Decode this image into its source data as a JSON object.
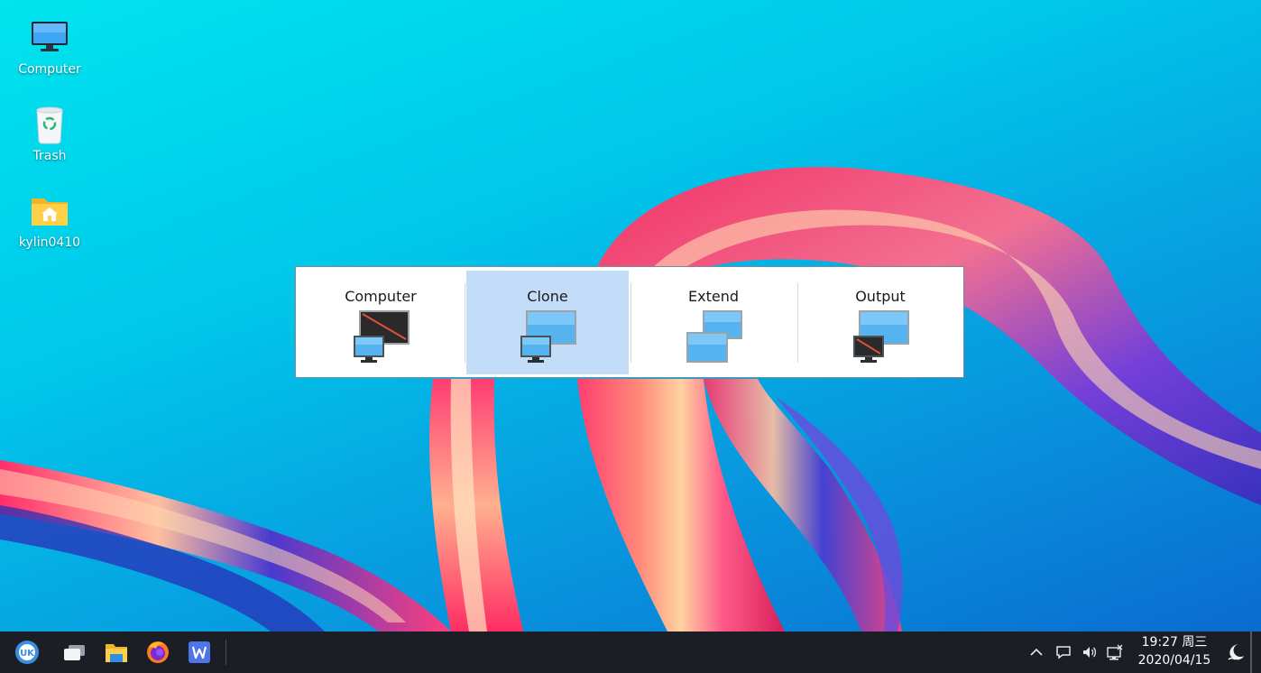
{
  "desktop": {
    "icons": [
      {
        "label": "Computer",
        "icon": "computer-icon"
      },
      {
        "label": "Trash",
        "icon": "trash-icon"
      },
      {
        "label": "kylin0410",
        "icon": "home-folder-icon"
      }
    ]
  },
  "display_switcher": {
    "selected": "Clone",
    "modes": [
      {
        "label": "Computer",
        "icon": "computer-only-mode-icon"
      },
      {
        "label": "Clone",
        "icon": "clone-mode-icon"
      },
      {
        "label": "Extend",
        "icon": "extend-mode-icon"
      },
      {
        "label": "Output",
        "icon": "output-only-mode-icon"
      }
    ]
  },
  "taskbar": {
    "apps": [
      {
        "name": "start-menu",
        "icon": "kylin-start-icon"
      },
      {
        "name": "multitask-view",
        "icon": "multitask-view-icon"
      },
      {
        "name": "file-manager",
        "icon": "file-manager-icon"
      },
      {
        "name": "firefox",
        "icon": "firefox-icon"
      },
      {
        "name": "wps-writer",
        "icon": "wps-writer-icon"
      }
    ],
    "tray_icons": [
      "tray-expand-icon",
      "chat-bubble-icon",
      "volume-icon",
      "network-icon"
    ],
    "clock": {
      "time": "19:27 周三",
      "date": "2020/04/15"
    },
    "night_mode_icon": "night-mode-icon"
  },
  "colors": {
    "selection": "#c3ddf8",
    "taskbar": "#1b1e24"
  }
}
